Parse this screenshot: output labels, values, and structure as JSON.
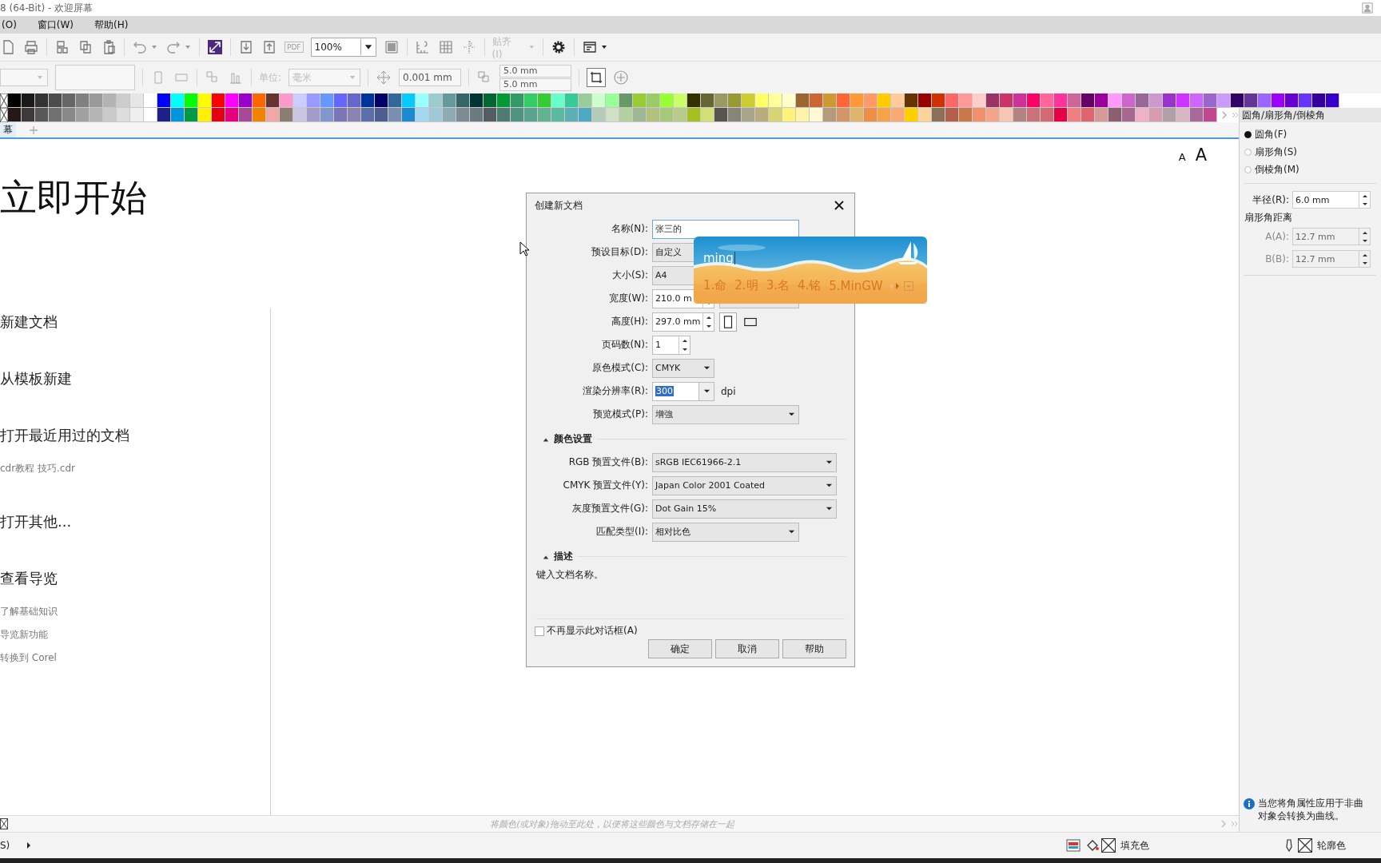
{
  "title_bar": {
    "title": "8 (64-Bit) - 欢迎屏幕"
  },
  "menu": [
    {
      "label": "(O)"
    },
    {
      "label": "窗口(W)"
    },
    {
      "label": "帮助(H)"
    }
  ],
  "toolbar": {
    "pdf_label": "PDF",
    "zoom": "100%",
    "snap": "贴齐(I)"
  },
  "property_bar": {
    "unit_label": "单位:",
    "unit": "毫米",
    "nudge": "0.001 mm",
    "dup_x": "5.0 mm",
    "dup_y": "5.0 mm"
  },
  "palette": {
    "rows": [
      {
        "swatches": [
          {
            "color": "#000000"
          },
          {
            "color": "#1a1a1a"
          },
          {
            "color": "#333333"
          },
          {
            "color": "#4d4d4d"
          },
          {
            "color": "#666666"
          },
          {
            "color": "#808080"
          },
          {
            "color": "#999999"
          },
          {
            "color": "#b3b3b3"
          },
          {
            "color": "#cccccc"
          },
          {
            "color": "#e6e6e6"
          },
          {
            "color": "#ffffff"
          },
          {
            "color": "#0000ff"
          },
          {
            "color": "#00ffff"
          },
          {
            "color": "#00ff00"
          },
          {
            "color": "#ffff00"
          },
          {
            "color": "#ff0000"
          },
          {
            "color": "#ff00ff"
          },
          {
            "color": "#9900cc"
          },
          {
            "color": "#ff6600"
          },
          {
            "color": "#663333"
          },
          {
            "color": "#ff99cc"
          },
          {
            "color": "#ccccff"
          },
          {
            "color": "#9999ff"
          },
          {
            "color": "#6699ff"
          },
          {
            "color": "#6666ff"
          },
          {
            "color": "#6666cc"
          },
          {
            "color": "#003399"
          },
          {
            "color": "#000066"
          },
          {
            "color": "#336699"
          },
          {
            "color": "#00ccff"
          },
          {
            "color": "#99ffff"
          },
          {
            "color": "#99cccc"
          },
          {
            "color": "#669999"
          },
          {
            "color": "#336666"
          },
          {
            "color": "#003333"
          },
          {
            "color": "#006633"
          },
          {
            "color": "#009933"
          },
          {
            "color": "#339966"
          },
          {
            "color": "#33cc66"
          },
          {
            "color": "#33cc33"
          },
          {
            "color": "#66ffcc"
          },
          {
            "color": "#33cc99"
          },
          {
            "color": "#99cc99"
          },
          {
            "color": "#ccffcc"
          },
          {
            "color": "#99ff99"
          },
          {
            "color": "#669966"
          },
          {
            "color": "#99cc33"
          },
          {
            "color": "#99cc66"
          },
          {
            "color": "#99ff33"
          },
          {
            "color": "#ccff66"
          },
          {
            "color": "#333300"
          },
          {
            "color": "#666633"
          },
          {
            "color": "#999966"
          },
          {
            "color": "#999933"
          },
          {
            "color": "#cccc33"
          },
          {
            "color": "#ffff66"
          },
          {
            "color": "#ffff99"
          },
          {
            "color": "#ffffcc"
          },
          {
            "color": "#996633"
          },
          {
            "color": "#cc6633"
          },
          {
            "color": "#cc9933"
          },
          {
            "color": "#ff6633"
          },
          {
            "color": "#ff9933"
          },
          {
            "color": "#ff9966"
          },
          {
            "color": "#ffcc00"
          },
          {
            "color": "#ffcc99"
          },
          {
            "color": "#663300"
          },
          {
            "color": "#990000"
          },
          {
            "color": "#cc3300"
          },
          {
            "color": "#ff6666"
          },
          {
            "color": "#ff9999"
          },
          {
            "color": "#ffcccc"
          },
          {
            "color": "#993366"
          },
          {
            "color": "#cc3366"
          },
          {
            "color": "#cc3399"
          },
          {
            "color": "#ff0066"
          },
          {
            "color": "#ff6699"
          },
          {
            "color": "#ff3399"
          },
          {
            "color": "#cc6699"
          },
          {
            "color": "#660066"
          },
          {
            "color": "#990099"
          },
          {
            "color": "#ff99ff"
          },
          {
            "color": "#cc66cc"
          },
          {
            "color": "#996699"
          },
          {
            "color": "#cc99cc"
          },
          {
            "color": "#9933cc"
          },
          {
            "color": "#cc33ff"
          },
          {
            "color": "#cc66ff"
          },
          {
            "color": "#9966cc"
          },
          {
            "color": "#cc99ff"
          },
          {
            "color": "#330066"
          },
          {
            "color": "#663399"
          },
          {
            "color": "#9966ff"
          },
          {
            "color": "#9900ff"
          },
          {
            "color": "#6600cc"
          },
          {
            "color": "#6633ff"
          },
          {
            "color": "#330099"
          },
          {
            "color": "#3300cc"
          }
        ]
      },
      {
        "swatches": [
          {
            "color": "#231815"
          },
          {
            "color": "#3e3a39"
          },
          {
            "color": "#595757"
          },
          {
            "color": "#727171"
          },
          {
            "color": "#898989"
          },
          {
            "color": "#9fa0a0"
          },
          {
            "color": "#b5b5b6"
          },
          {
            "color": "#c9caca"
          },
          {
            "color": "#dcdddd"
          },
          {
            "color": "#efefef"
          },
          {
            "color": "#ffffff"
          },
          {
            "color": "#1d2088"
          },
          {
            "color": "#0095d9"
          },
          {
            "color": "#009944"
          },
          {
            "color": "#fff100"
          },
          {
            "color": "#e60012"
          },
          {
            "color": "#e4007f"
          },
          {
            "color": "#a64a97"
          },
          {
            "color": "#f08300"
          },
          {
            "color": "#f2a7a7"
          },
          {
            "color": "#8b7d72"
          },
          {
            "color": "#c9c4e2"
          },
          {
            "color": "#a29bcc"
          },
          {
            "color": "#8497cc"
          },
          {
            "color": "#7b74b7"
          },
          {
            "color": "#8a82b0"
          },
          {
            "color": "#5a6fa8"
          },
          {
            "color": "#4e5d8f"
          },
          {
            "color": "#7a8eb0"
          },
          {
            "color": "#1a8bd0"
          },
          {
            "color": "#a3d8f0"
          },
          {
            "color": "#9fc8d8"
          },
          {
            "color": "#8eabb4"
          },
          {
            "color": "#7d8b93"
          },
          {
            "color": "#6b7a7f"
          },
          {
            "color": "#535d63"
          },
          {
            "color": "#4e7a72"
          },
          {
            "color": "#4f9480"
          },
          {
            "color": "#5aa38f"
          },
          {
            "color": "#62b292"
          },
          {
            "color": "#5bb9a0"
          },
          {
            "color": "#5ab0b5"
          },
          {
            "color": "#4fa8c2"
          },
          {
            "color": "#b4cbb8"
          },
          {
            "color": "#cfe0c7"
          },
          {
            "color": "#b3d1a0"
          },
          {
            "color": "#9fb594"
          },
          {
            "color": "#b3c27a"
          },
          {
            "color": "#a8c87a"
          },
          {
            "color": "#b8cc8a"
          },
          {
            "color": "#a5c020"
          },
          {
            "color": "#d1df74"
          },
          {
            "color": "#58554f"
          },
          {
            "color": "#878576"
          },
          {
            "color": "#a7a68d"
          },
          {
            "color": "#b8ad7a"
          },
          {
            "color": "#d9d473"
          },
          {
            "color": "#fff27a"
          },
          {
            "color": "#fff3a8"
          },
          {
            "color": "#fff9d6"
          },
          {
            "color": "#b59b7a"
          },
          {
            "color": "#d19768"
          },
          {
            "color": "#deb56b"
          },
          {
            "color": "#f08d46"
          },
          {
            "color": "#f5a34a"
          },
          {
            "color": "#f8aa72"
          },
          {
            "color": "#ffcf00"
          },
          {
            "color": "#fcd39a"
          },
          {
            "color": "#8a7059"
          },
          {
            "color": "#b35e4c"
          },
          {
            "color": "#c9784a"
          },
          {
            "color": "#f0906d"
          },
          {
            "color": "#f4a48a"
          },
          {
            "color": "#f6c6b2"
          },
          {
            "color": "#b38282"
          },
          {
            "color": "#c97279"
          },
          {
            "color": "#d06b73"
          },
          {
            "color": "#e60044"
          },
          {
            "color": "#f08080"
          },
          {
            "color": "#e0636e"
          },
          {
            "color": "#d69999"
          },
          {
            "color": "#8a6070"
          },
          {
            "color": "#a6688e"
          },
          {
            "color": "#f0b0c8"
          },
          {
            "color": "#d89cb0"
          },
          {
            "color": "#b2a0a8"
          },
          {
            "color": "#d8b7c5"
          },
          {
            "color": "#a8689a"
          },
          {
            "color": "#c04890"
          }
        ]
      }
    ]
  },
  "tabs": [
    {
      "label": "幕",
      "selected": true
    }
  ],
  "font_buttons": [
    {
      "label": "A",
      "kind": "smaller"
    },
    {
      "label": "A",
      "kind": "larger"
    }
  ],
  "welcome": {
    "heading": "立即开始",
    "items": [
      {
        "kind": "action",
        "label": "新建文档"
      },
      {
        "kind": "action",
        "label": "从模板新建"
      },
      {
        "kind": "action",
        "label": "打开最近用过的文档"
      },
      {
        "kind": "file",
        "label": "cdr教程 技巧.cdr"
      },
      {
        "kind": "action",
        "label": "打开其他..."
      },
      {
        "kind": "action",
        "label": "查看导览"
      },
      {
        "kind": "link",
        "label": "了解基础知识"
      },
      {
        "kind": "link",
        "label": "导览新功能"
      },
      {
        "kind": "link",
        "label": "转换到 Corel"
      }
    ]
  },
  "dialog": {
    "title": "创建新文档",
    "fields": [
      {
        "kind": "text",
        "label": "名称(N):",
        "value": "张三的"
      },
      {
        "kind": "coveredselect",
        "label": "预设目标(D):",
        "value": "自定义"
      },
      {
        "kind": "coveredselect",
        "label": "大小(S):",
        "value": "A4"
      },
      {
        "kind": "spin",
        "label": "宽度(W):",
        "value": "210.0 m",
        "extra_select": true
      },
      {
        "kind": "spin",
        "label": "高度(H):",
        "value": "297.0 mm",
        "orientation": [
          {
            "kind": "portrait",
            "selected": true
          },
          {
            "kind": "landscape",
            "selected": false
          }
        ]
      },
      {
        "kind": "smallspin",
        "label": "页码数(N):",
        "value": "1"
      },
      {
        "kind": "smallselect",
        "label": "原色模式(C):",
        "value": "CMYK"
      },
      {
        "kind": "combo",
        "label": "渲染分辨率(R):",
        "value": "300",
        "text_selected": true,
        "unit": "dpi"
      },
      {
        "kind": "select",
        "label": "预览模式(P):",
        "value": "增強"
      }
    ],
    "sections": [
      {
        "title": "颜色设置",
        "expanded": true,
        "fields": [
          {
            "kind": "wideselect",
            "label": "RGB 预置文件(B):",
            "value": "sRGB IEC61966-2.1"
          },
          {
            "kind": "wideselect",
            "label": "CMYK 预置文件(Y):",
            "value": "Japan Color 2001 Coated"
          },
          {
            "kind": "wideselect",
            "label": "灰度预置文件(G):",
            "value": "Dot Gain 15%"
          },
          {
            "kind": "select",
            "label": "匹配类型(I):",
            "value": "相对比色"
          }
        ]
      },
      {
        "title": "描述",
        "expanded": true,
        "text": "键入文档名称。"
      }
    ],
    "checkbox": {
      "label": "不再显示此对话框(A)",
      "checked": false
    },
    "buttons": [
      "确定",
      "取消",
      "帮助"
    ]
  },
  "ime": {
    "input": "ming",
    "candidates": [
      "1.命",
      "2.明",
      "3.名",
      "4.铭",
      "5.MinGW"
    ]
  },
  "docker": {
    "title": "圆角/扇形角/倒棱角",
    "options": [
      {
        "label": "圆角(F)",
        "selected": true
      },
      {
        "label": "扇形角(S)",
        "selected": false
      },
      {
        "label": "倒棱角(M)",
        "selected": false
      }
    ],
    "radius": {
      "label": "半径(R):",
      "value": "6.0 mm"
    },
    "distance_label": "扇形角距离",
    "distances": [
      {
        "label": "A(A):",
        "value": "12.7 mm",
        "disabled": true
      },
      {
        "label": "B(B):",
        "value": "12.7 mm",
        "disabled": true
      }
    ],
    "info_lines": [
      "当您将角属性应用于非曲",
      "对象会转换为曲线。"
    ]
  },
  "hint_bar": {
    "text": "将颜色(或对象)拖动至此处，以便将这些颜色与文档存储在一起"
  },
  "status_bar": {
    "left": "S)",
    "fill_label": "填充色",
    "outline_label": "轮廓色"
  }
}
